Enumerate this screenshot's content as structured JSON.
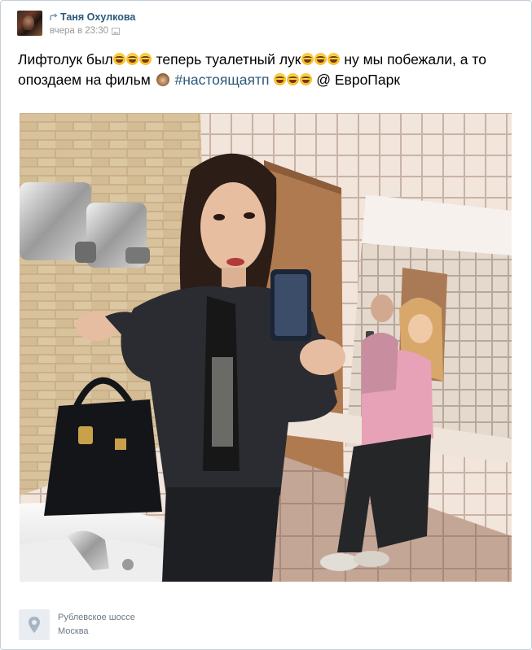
{
  "post": {
    "author": "Таня Охулкова",
    "time": "вчера в 23:30",
    "text_parts": {
      "p1": "Лифтолук был",
      "p2": " теперь туалетный лук",
      "p3": " ну мы побежали, а то опоздаем на фильм ",
      "hashtag": "#настоящаятп",
      "p4": " @ ЕвроПарк"
    }
  },
  "place": {
    "line1": "Рублевское шоссе",
    "line2": "Москва"
  },
  "icons": {
    "repost": "repost-arrow-icon",
    "photo": "photo-icon",
    "emoji": "tears-of-joy-emoji",
    "monkey": "see-no-evil-monkey-emoji",
    "location": "map-pin-icon"
  },
  "colors": {
    "link": "#2b587a",
    "muted": "#999999",
    "border": "#c5d0db"
  }
}
